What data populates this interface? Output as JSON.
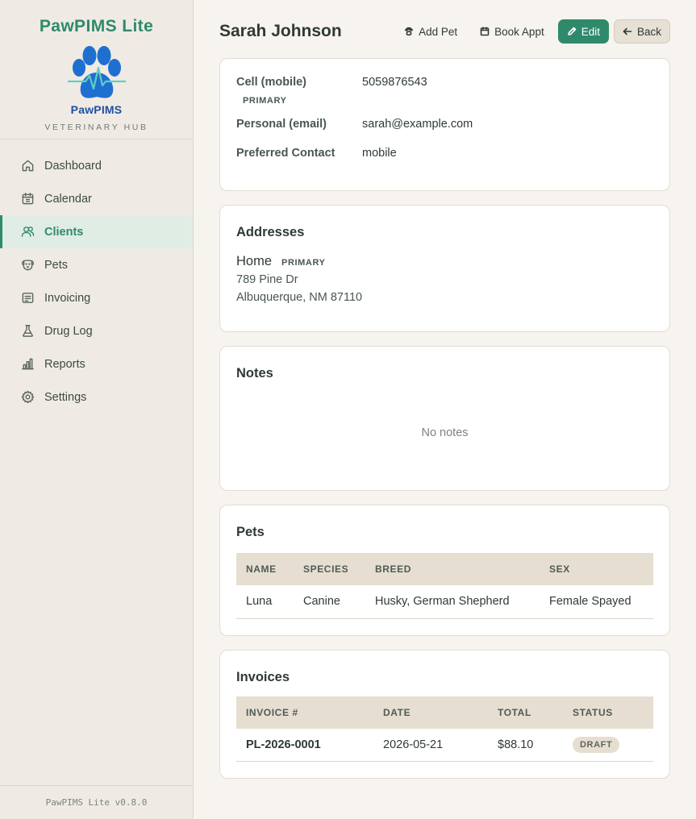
{
  "app": {
    "title": "PawPIMS Lite",
    "logo_text": "PawPIMS",
    "tagline": "VETERINARY HUB",
    "version": "PawPIMS Lite v0.8.0"
  },
  "colors": {
    "accent": "#2f8a6c",
    "sidebar_bg": "#efebe4",
    "page_bg": "#f7f4ef",
    "logo_blue": "#1f6fd0"
  },
  "nav": {
    "items": [
      {
        "label": "Dashboard",
        "icon": "home-icon"
      },
      {
        "label": "Calendar",
        "icon": "calendar-icon"
      },
      {
        "label": "Clients",
        "icon": "users-icon",
        "active": true
      },
      {
        "label": "Pets",
        "icon": "dog-icon"
      },
      {
        "label": "Invoicing",
        "icon": "invoice-icon"
      },
      {
        "label": "Drug Log",
        "icon": "flask-icon"
      },
      {
        "label": "Reports",
        "icon": "bar-chart-icon"
      },
      {
        "label": "Settings",
        "icon": "gear-icon"
      }
    ]
  },
  "header": {
    "title": "Sarah Johnson",
    "add_pet": "Add Pet",
    "book_appt": "Book Appt",
    "edit": "Edit",
    "back": "Back"
  },
  "contact": {
    "rows": [
      {
        "label": "Cell (mobile)",
        "value": "5059876543",
        "badge": "PRIMARY"
      },
      {
        "label": "Personal (email)",
        "value": "sarah@example.com"
      },
      {
        "label": "Preferred Contact",
        "value": "mobile"
      }
    ]
  },
  "addresses": {
    "title": "Addresses",
    "items": [
      {
        "name": "Home",
        "badge": "PRIMARY",
        "line1": "789 Pine Dr",
        "line2": "Albuquerque, NM 87110"
      }
    ]
  },
  "notes": {
    "title": "Notes",
    "empty": "No notes"
  },
  "pets": {
    "title": "Pets",
    "columns": [
      "NAME",
      "SPECIES",
      "BREED",
      "SEX"
    ],
    "rows": [
      [
        "Luna",
        "Canine",
        "Husky, German Shepherd",
        "Female Spayed"
      ]
    ]
  },
  "invoices": {
    "title": "Invoices",
    "columns": [
      "INVOICE #",
      "DATE",
      "TOTAL",
      "STATUS"
    ],
    "rows": [
      {
        "number": "PL-2026-0001",
        "date": "2026-05-21",
        "total": "$88.10",
        "status": "DRAFT"
      }
    ]
  }
}
